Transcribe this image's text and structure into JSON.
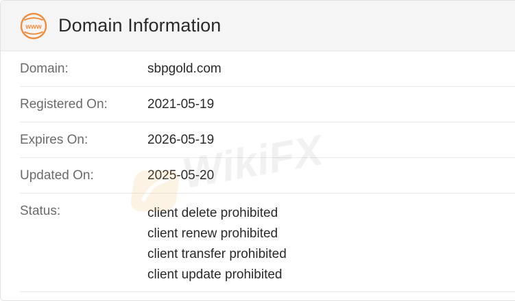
{
  "header": {
    "icon": "www-globe-icon",
    "title": "Domain Information",
    "accent_color": "#f08c3e"
  },
  "fields": [
    {
      "label": "Domain:",
      "value": "sbpgold.com"
    },
    {
      "label": "Registered On:",
      "value": "2021-05-19"
    },
    {
      "label": "Expires On:",
      "value": "2026-05-19"
    },
    {
      "label": "Updated On:",
      "value": "2025-05-20"
    }
  ],
  "status": {
    "label": "Status:",
    "values": [
      "client delete prohibited",
      "client renew prohibited",
      "client transfer prohibited",
      "client update prohibited"
    ]
  },
  "watermark": {
    "text": "WikiFX"
  }
}
